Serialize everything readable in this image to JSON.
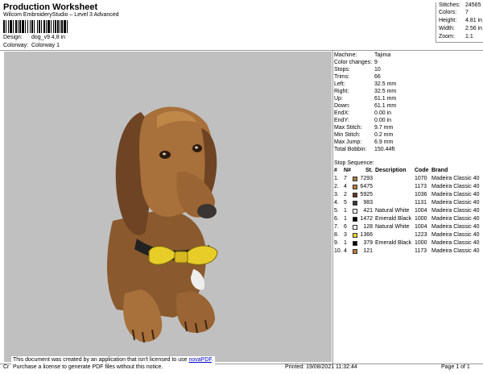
{
  "header": {
    "title": "Production Worksheet",
    "subtitle": "Wilcom EmbroideryStudio – Level 3 Advanced",
    "design_label": "Design:",
    "design_value": "dog_v9 4,8 in",
    "colorway_label": "Colorway:",
    "colorway_value": "Colorway 1"
  },
  "summary": [
    {
      "label": "Stitches:",
      "value": "24565"
    },
    {
      "label": "Colors:",
      "value": "7"
    },
    {
      "label": "Height:",
      "value": "4.81 in"
    },
    {
      "label": "Width:",
      "value": "2.56 in"
    },
    {
      "label": "Zoom:",
      "value": "1:1"
    }
  ],
  "machine_info": [
    {
      "label": "Machine:",
      "value": "Tajima"
    },
    {
      "label": "Color changes:",
      "value": "9"
    },
    {
      "label": "Stops:",
      "value": "10"
    },
    {
      "label": "Trims:",
      "value": "66"
    },
    {
      "label": "Left:",
      "value": "32.5 mm"
    },
    {
      "label": "Right:",
      "value": "32.5 mm"
    },
    {
      "label": "Up:",
      "value": "61.1 mm"
    },
    {
      "label": "Down:",
      "value": "61.1 mm"
    },
    {
      "label": "EndX:",
      "value": "0.00 in"
    },
    {
      "label": "EndY:",
      "value": "0.00 in"
    },
    {
      "label": "Max Stitch:",
      "value": "9.7 mm"
    },
    {
      "label": "Min Stitch:",
      "value": "0.2 mm"
    },
    {
      "label": "Max Jump:",
      "value": "6.9 mm"
    },
    {
      "label": "Total Bobbin:",
      "value": "150.44ft"
    }
  ],
  "stop_sequence": {
    "title": "Stop Sequence:",
    "headers": [
      "#",
      "N#",
      "St.",
      "Description",
      "Code",
      "Brand"
    ],
    "rows": [
      {
        "num": "1.",
        "n": "7",
        "color": "#b07a3c",
        "st": "7293",
        "desc": "",
        "code": "1070",
        "brand": "Madeira Classic 40"
      },
      {
        "num": "2.",
        "n": "4",
        "color": "#c0783a",
        "st": "6475",
        "desc": "",
        "code": "1173",
        "brand": "Madeira Classic 40"
      },
      {
        "num": "3.",
        "n": "2",
        "color": "#6a2f22",
        "st": "5925",
        "desc": "",
        "code": "1036",
        "brand": "Madeira Classic 40"
      },
      {
        "num": "4.",
        "n": "5",
        "color": "#3a3838",
        "st": "983",
        "desc": "",
        "code": "1131",
        "brand": "Madeira Classic 40"
      },
      {
        "num": "5.",
        "n": "1",
        "color": "#f2f2f2",
        "st": "421",
        "desc": "Natural White",
        "code": "1004",
        "brand": "Madeira Classic 40"
      },
      {
        "num": "6.",
        "n": "1",
        "color": "#050505",
        "st": "1472",
        "desc": "Emerald Black",
        "code": "1000",
        "brand": "Madeira Classic 40"
      },
      {
        "num": "7.",
        "n": "6",
        "color": "#f2f2f2",
        "st": "128",
        "desc": "Natural White",
        "code": "1004",
        "brand": "Madeira Classic 40"
      },
      {
        "num": "8.",
        "n": "3",
        "color": "#f0d226",
        "st": "1366",
        "desc": "",
        "code": "1223",
        "brand": "Madeira Classic 40"
      },
      {
        "num": "9.",
        "n": "1",
        "color": "#050505",
        "st": "379",
        "desc": "Emerald Black",
        "code": "1000",
        "brand": "Madeira Classic 40"
      },
      {
        "num": "10.",
        "n": "4",
        "color": "#c0783a",
        "st": "121",
        "desc": "",
        "code": "1173",
        "brand": "Madeira Classic 40"
      }
    ]
  },
  "notice": {
    "line1_prefix": "This document was created by an application that isn't licensed to use ",
    "link": "novaPDF",
    "line1_suffix": ".",
    "line2": "Purchase a license to generate PDF files without this notice."
  },
  "footer": {
    "left": "Cr",
    "printed": "Printed: 19/08/2021 11:32:44",
    "page": "Page 1 of 1"
  },
  "colors": {
    "design_bg": "#c0c0c0",
    "rule": "#9a9a9a",
    "link": "#0000cc"
  }
}
